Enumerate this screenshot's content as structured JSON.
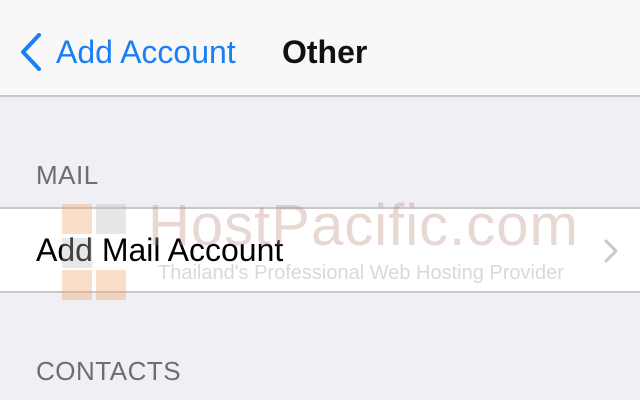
{
  "nav": {
    "back_label": "Add Account",
    "title": "Other"
  },
  "sections": {
    "mail_header": "MAIL",
    "mail_item_label": "Add Mail Account",
    "contacts_header": "CONTACTS"
  },
  "watermark": {
    "brand": "HostPacific.com",
    "tagline": "Thailand's Professional Web Hosting Provider"
  },
  "icons": {
    "back": "chevron-left-icon",
    "disclosure": "chevron-right-icon"
  },
  "colors": {
    "accent": "#1a7ff5",
    "background": "#efeff4",
    "nav_background": "#f8f8f8",
    "cell_background": "#ffffff",
    "separator": "#c8c7cc",
    "section_header_text": "#6d6d72"
  }
}
